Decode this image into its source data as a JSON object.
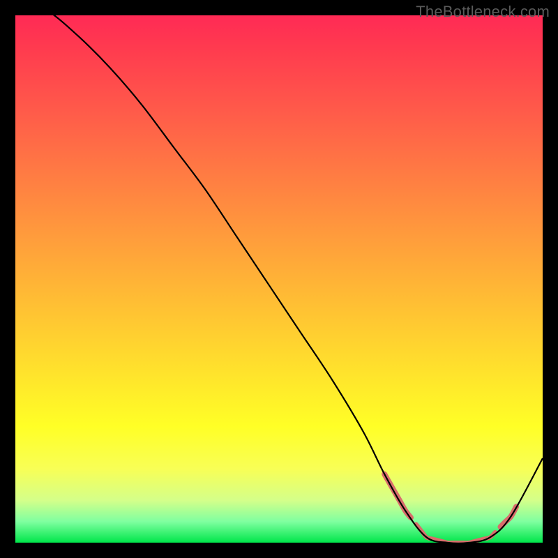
{
  "watermark": "TheBottleneck.com",
  "chart_data": {
    "type": "line",
    "title": "",
    "xlabel": "",
    "ylabel": "",
    "xlim": [
      0,
      100
    ],
    "ylim": [
      0,
      100
    ],
    "grid": false,
    "series": [
      {
        "name": "bottleneck-curve",
        "color": "#000000",
        "x": [
          0,
          6,
          12,
          18,
          24,
          30,
          36,
          42,
          48,
          54,
          60,
          66,
          70,
          74,
          78,
          82,
          86,
          90,
          94,
          100
        ],
        "y": [
          104,
          101,
          96,
          90,
          83,
          75,
          67,
          58,
          49,
          40,
          31,
          21,
          13,
          6,
          1,
          0,
          0,
          1,
          5,
          16
        ]
      }
    ],
    "segments": [
      {
        "name": "steep-segment",
        "color": "#d86d6b",
        "x_range": [
          70,
          75
        ],
        "thickness": 8
      },
      {
        "name": "valley-segment",
        "color": "#d86d6b",
        "x_range": [
          76,
          91
        ],
        "thickness": 6
      },
      {
        "name": "rise-segment",
        "color": "#d86d6b",
        "x_range": [
          92,
          95
        ],
        "thickness": 8
      }
    ],
    "background_gradient": {
      "top": "#ff2a55",
      "mid": "#ffde2d",
      "bottom": "#00e64a"
    }
  }
}
